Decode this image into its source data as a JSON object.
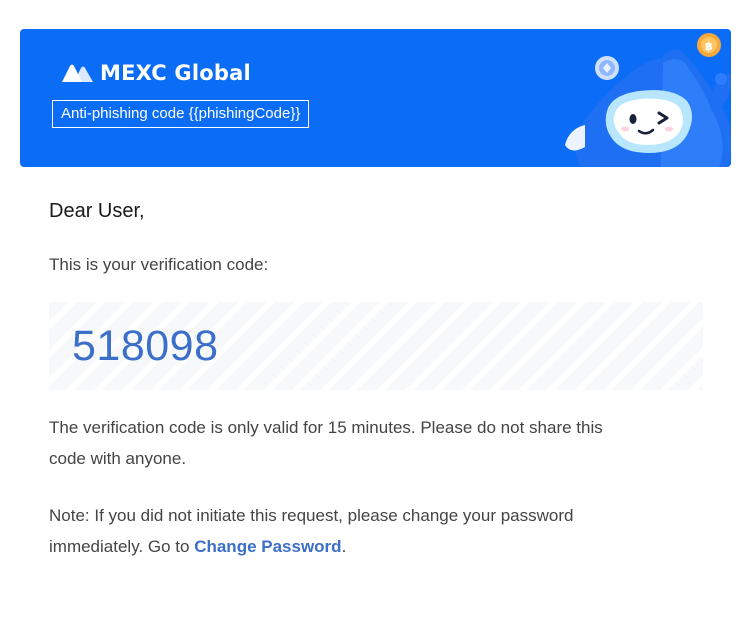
{
  "banner": {
    "brand_name": "MEXC Global",
    "anti_phishing_label": "Anti-phishing code {{phishingCode}}",
    "mascot_icon": "mexc-mascot-illustration",
    "logo_icon": "mexc-logo-icon",
    "colors": {
      "background": "#0b6df6",
      "text": "#ffffff"
    }
  },
  "body": {
    "greeting": "Dear User,",
    "intro": "This is your verification code:",
    "verification_code": "518098",
    "validity_text_line1": "The verification code is only valid for 15 minutes. Please do not share this",
    "validity_text_line2": "code with anyone.",
    "note_line1": "Note: If you did not initiate this request, please change your password",
    "note_line2_prefix": "immediately. Go to ",
    "change_password_link": "Change Password",
    "note_line2_suffix": ".",
    "colors": {
      "code": "#3b6fc9",
      "link": "#3b6fc9",
      "text": "#444444"
    }
  }
}
